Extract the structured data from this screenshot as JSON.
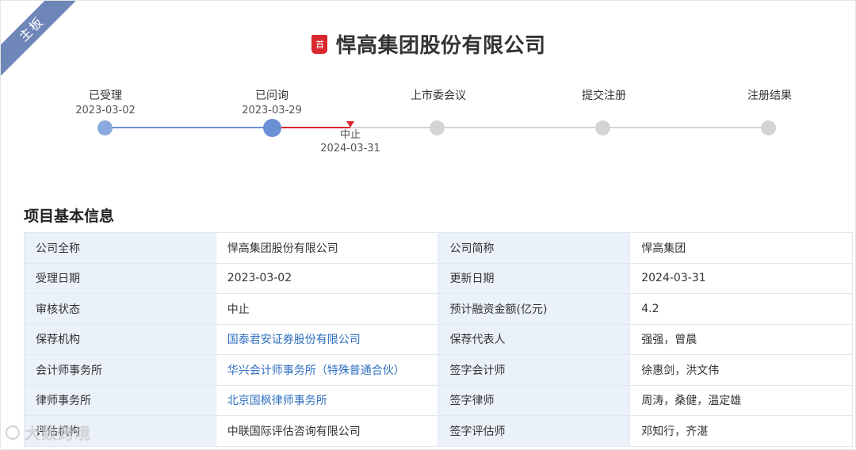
{
  "ribbon": {
    "label": "主板"
  },
  "header": {
    "badge": "首",
    "company_name": "悍高集团股份有限公司"
  },
  "timeline": {
    "stages": [
      {
        "label": "已受理",
        "date": "2023-03-02",
        "status": "done"
      },
      {
        "label": "已问询",
        "date": "2023-03-29",
        "status": "current"
      },
      {
        "label": "上市委会议",
        "date": "",
        "status": "pending"
      },
      {
        "label": "提交注册",
        "date": "",
        "status": "pending"
      },
      {
        "label": "注册结果",
        "date": "",
        "status": "pending"
      }
    ],
    "stop": {
      "label": "中止",
      "date": "2024-03-31"
    },
    "colors": {
      "done": "#6b8fd4",
      "stop": "#d9272e",
      "pending": "#d4d4d4"
    }
  },
  "section": {
    "title": "项目基本信息"
  },
  "info_table": {
    "rows": [
      {
        "label1": "公司全称",
        "value1": "悍高集团股份有限公司",
        "label2": "公司简称",
        "value2": "悍高集团"
      },
      {
        "label1": "受理日期",
        "value1": "2023-03-02",
        "label2": "更新日期",
        "value2": "2024-03-31"
      },
      {
        "label1": "审核状态",
        "value1": "中止",
        "label2": "预计融资金额(亿元)",
        "value2": "4.2"
      },
      {
        "label1": "保荐机构",
        "value1": "国泰君安证券股份有限公司",
        "label2": "保荐代表人",
        "value2": "强强，曾晨"
      },
      {
        "label1": "会计师事务所",
        "value1": "华兴会计师事务所（特殊普通合伙）",
        "label2": "签字会计师",
        "value2": "徐惠剑，洪文伟"
      },
      {
        "label1": "律师事务所",
        "value1": "北京国枫律师事务所",
        "label2": "签字律师",
        "value2": "周涛，桑健，温定雄"
      },
      {
        "label1": "评估机构",
        "value1": "中联国际评估咨询有限公司",
        "label2": "签字评估师",
        "value2": "邓知行，齐湛"
      }
    ]
  },
  "watermark": {
    "text": "大数跨境"
  }
}
